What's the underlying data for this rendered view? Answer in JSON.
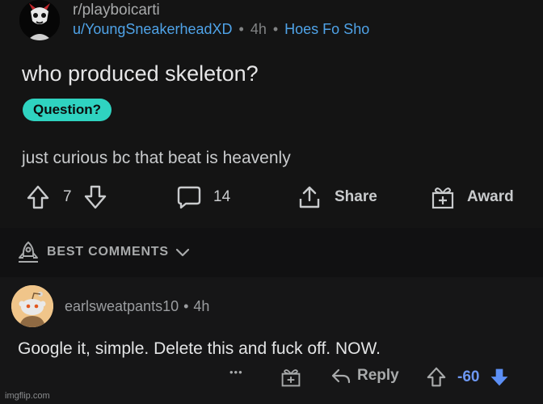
{
  "post": {
    "subreddit": "r/playboicarti",
    "author": "u/YoungSneakerheadXD",
    "age": "4h",
    "meta_flair": "Hoes Fo Sho",
    "title": "who produced skeleton?",
    "flair": "Question?",
    "body": "just curious bc that beat is heavenly",
    "upvotes": "7",
    "comments": "14",
    "share_label": "Share",
    "award_label": "Award"
  },
  "sort": {
    "label": "BEST COMMENTS"
  },
  "comment": {
    "author": "earlsweatpants10",
    "age": "4h",
    "text": "Google it, simple. Delete this and fuck off. NOW.",
    "more": "•••",
    "reply_label": "Reply",
    "score": "-60"
  },
  "watermark": "imgflip.com",
  "colors": {
    "accent_link": "#4fa3e8",
    "flair_bg": "#2fd3c0",
    "downvote": "#5c8ff5"
  },
  "icons": [
    "subreddit-avatar-icon",
    "upvote-icon",
    "downvote-icon",
    "comment-icon",
    "share-icon",
    "award-icon",
    "rocket-icon",
    "chevron-down-icon",
    "snoo-avatar-icon",
    "more-icon",
    "reply-icon"
  ]
}
